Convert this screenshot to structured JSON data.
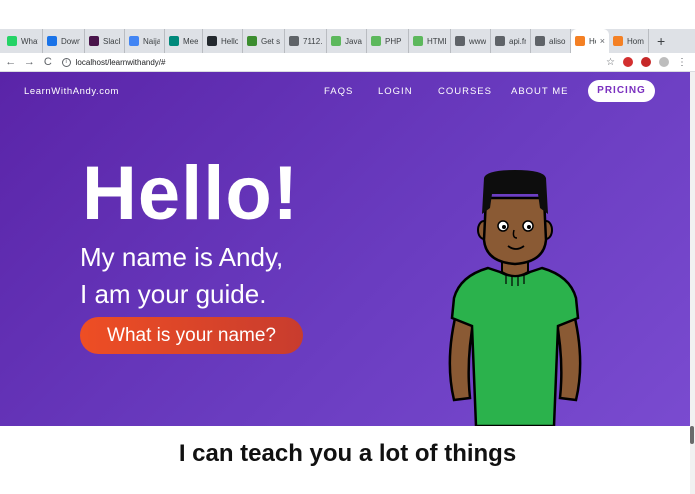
{
  "browser": {
    "tabs": [
      {
        "title": "WhatsApp",
        "icon": "whatsapp-icon",
        "color": "#25d366"
      },
      {
        "title": "Downloads",
        "icon": "download-icon",
        "color": "#1a73e8"
      },
      {
        "title": "Slack",
        "icon": "slack-icon",
        "color": "#4a154b"
      },
      {
        "title": "Naijab",
        "icon": "docs-icon",
        "color": "#4285f4"
      },
      {
        "title": "Meet",
        "icon": "meet-icon",
        "color": "#00897b"
      },
      {
        "title": "Hello",
        "icon": "github-icon",
        "color": "#24292e"
      },
      {
        "title": "Get st",
        "icon": "leaf-icon",
        "color": "#3c8d2f"
      },
      {
        "title": "7112...",
        "icon": "globe-icon",
        "color": "#5f6368"
      },
      {
        "title": "Java",
        "icon": "green-square-icon",
        "color": "#5cb85c"
      },
      {
        "title": "PHP F",
        "icon": "green-square-icon",
        "color": "#5cb85c"
      },
      {
        "title": "HTML",
        "icon": "green-square-icon",
        "color": "#5cb85c"
      },
      {
        "title": "www.",
        "icon": "globe-icon",
        "color": "#5f6368"
      },
      {
        "title": "api.fm",
        "icon": "globe-icon",
        "color": "#5f6368"
      },
      {
        "title": "alison",
        "icon": "globe-icon",
        "color": "#5f6368"
      }
    ],
    "active_tab": {
      "title": "Ho",
      "icon": "orange-box-icon",
      "color": "#f48024",
      "close": "×"
    },
    "last_tab": {
      "title": "Home",
      "icon": "orange-box-icon",
      "color": "#f48024"
    },
    "new_tab": "+",
    "back": "←",
    "forward": "→",
    "reload": "C",
    "info": "i",
    "url": "localhost/learnwithandy/#",
    "star": "☆",
    "menu": "⋮"
  },
  "site": {
    "brand": "LearnWithAndy.com",
    "nav": {
      "faqs": "FAQS",
      "login": "LOGIN",
      "courses": "COURSES",
      "about": "ABOUT ME",
      "pricing": "PRICING"
    },
    "hero": {
      "title": "Hello!",
      "line1": "My name is Andy,",
      "line2": "I am your guide.",
      "button": "What is your name?"
    },
    "tagline": "I can teach you a lot of things"
  },
  "colors": {
    "hero_purple": "#5a24a8",
    "pricing_text": "#7a2fbf",
    "button_orange": "#ee4e24",
    "shirt_green": "#2bb24c"
  }
}
